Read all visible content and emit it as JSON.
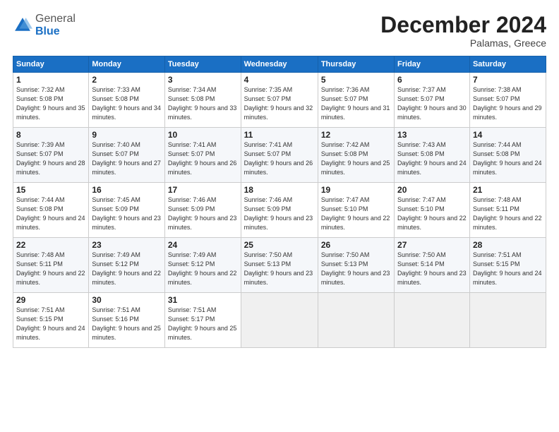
{
  "logo": {
    "general": "General",
    "blue": "Blue"
  },
  "header": {
    "month": "December 2024",
    "location": "Palamas, Greece"
  },
  "weekdays": [
    "Sunday",
    "Monday",
    "Tuesday",
    "Wednesday",
    "Thursday",
    "Friday",
    "Saturday"
  ],
  "weeks": [
    [
      {
        "day": "1",
        "sunrise": "Sunrise: 7:32 AM",
        "sunset": "Sunset: 5:08 PM",
        "daylight": "Daylight: 9 hours and 35 minutes."
      },
      {
        "day": "2",
        "sunrise": "Sunrise: 7:33 AM",
        "sunset": "Sunset: 5:08 PM",
        "daylight": "Daylight: 9 hours and 34 minutes."
      },
      {
        "day": "3",
        "sunrise": "Sunrise: 7:34 AM",
        "sunset": "Sunset: 5:08 PM",
        "daylight": "Daylight: 9 hours and 33 minutes."
      },
      {
        "day": "4",
        "sunrise": "Sunrise: 7:35 AM",
        "sunset": "Sunset: 5:07 PM",
        "daylight": "Daylight: 9 hours and 32 minutes."
      },
      {
        "day": "5",
        "sunrise": "Sunrise: 7:36 AM",
        "sunset": "Sunset: 5:07 PM",
        "daylight": "Daylight: 9 hours and 31 minutes."
      },
      {
        "day": "6",
        "sunrise": "Sunrise: 7:37 AM",
        "sunset": "Sunset: 5:07 PM",
        "daylight": "Daylight: 9 hours and 30 minutes."
      },
      {
        "day": "7",
        "sunrise": "Sunrise: 7:38 AM",
        "sunset": "Sunset: 5:07 PM",
        "daylight": "Daylight: 9 hours and 29 minutes."
      }
    ],
    [
      {
        "day": "8",
        "sunrise": "Sunrise: 7:39 AM",
        "sunset": "Sunset: 5:07 PM",
        "daylight": "Daylight: 9 hours and 28 minutes."
      },
      {
        "day": "9",
        "sunrise": "Sunrise: 7:40 AM",
        "sunset": "Sunset: 5:07 PM",
        "daylight": "Daylight: 9 hours and 27 minutes."
      },
      {
        "day": "10",
        "sunrise": "Sunrise: 7:41 AM",
        "sunset": "Sunset: 5:07 PM",
        "daylight": "Daylight: 9 hours and 26 minutes."
      },
      {
        "day": "11",
        "sunrise": "Sunrise: 7:41 AM",
        "sunset": "Sunset: 5:07 PM",
        "daylight": "Daylight: 9 hours and 26 minutes."
      },
      {
        "day": "12",
        "sunrise": "Sunrise: 7:42 AM",
        "sunset": "Sunset: 5:08 PM",
        "daylight": "Daylight: 9 hours and 25 minutes."
      },
      {
        "day": "13",
        "sunrise": "Sunrise: 7:43 AM",
        "sunset": "Sunset: 5:08 PM",
        "daylight": "Daylight: 9 hours and 24 minutes."
      },
      {
        "day": "14",
        "sunrise": "Sunrise: 7:44 AM",
        "sunset": "Sunset: 5:08 PM",
        "daylight": "Daylight: 9 hours and 24 minutes."
      }
    ],
    [
      {
        "day": "15",
        "sunrise": "Sunrise: 7:44 AM",
        "sunset": "Sunset: 5:08 PM",
        "daylight": "Daylight: 9 hours and 24 minutes."
      },
      {
        "day": "16",
        "sunrise": "Sunrise: 7:45 AM",
        "sunset": "Sunset: 5:09 PM",
        "daylight": "Daylight: 9 hours and 23 minutes."
      },
      {
        "day": "17",
        "sunrise": "Sunrise: 7:46 AM",
        "sunset": "Sunset: 5:09 PM",
        "daylight": "Daylight: 9 hours and 23 minutes."
      },
      {
        "day": "18",
        "sunrise": "Sunrise: 7:46 AM",
        "sunset": "Sunset: 5:09 PM",
        "daylight": "Daylight: 9 hours and 23 minutes."
      },
      {
        "day": "19",
        "sunrise": "Sunrise: 7:47 AM",
        "sunset": "Sunset: 5:10 PM",
        "daylight": "Daylight: 9 hours and 22 minutes."
      },
      {
        "day": "20",
        "sunrise": "Sunrise: 7:47 AM",
        "sunset": "Sunset: 5:10 PM",
        "daylight": "Daylight: 9 hours and 22 minutes."
      },
      {
        "day": "21",
        "sunrise": "Sunrise: 7:48 AM",
        "sunset": "Sunset: 5:11 PM",
        "daylight": "Daylight: 9 hours and 22 minutes."
      }
    ],
    [
      {
        "day": "22",
        "sunrise": "Sunrise: 7:48 AM",
        "sunset": "Sunset: 5:11 PM",
        "daylight": "Daylight: 9 hours and 22 minutes."
      },
      {
        "day": "23",
        "sunrise": "Sunrise: 7:49 AM",
        "sunset": "Sunset: 5:12 PM",
        "daylight": "Daylight: 9 hours and 22 minutes."
      },
      {
        "day": "24",
        "sunrise": "Sunrise: 7:49 AM",
        "sunset": "Sunset: 5:12 PM",
        "daylight": "Daylight: 9 hours and 22 minutes."
      },
      {
        "day": "25",
        "sunrise": "Sunrise: 7:50 AM",
        "sunset": "Sunset: 5:13 PM",
        "daylight": "Daylight: 9 hours and 23 minutes."
      },
      {
        "day": "26",
        "sunrise": "Sunrise: 7:50 AM",
        "sunset": "Sunset: 5:13 PM",
        "daylight": "Daylight: 9 hours and 23 minutes."
      },
      {
        "day": "27",
        "sunrise": "Sunrise: 7:50 AM",
        "sunset": "Sunset: 5:14 PM",
        "daylight": "Daylight: 9 hours and 23 minutes."
      },
      {
        "day": "28",
        "sunrise": "Sunrise: 7:51 AM",
        "sunset": "Sunset: 5:15 PM",
        "daylight": "Daylight: 9 hours and 24 minutes."
      }
    ],
    [
      {
        "day": "29",
        "sunrise": "Sunrise: 7:51 AM",
        "sunset": "Sunset: 5:15 PM",
        "daylight": "Daylight: 9 hours and 24 minutes."
      },
      {
        "day": "30",
        "sunrise": "Sunrise: 7:51 AM",
        "sunset": "Sunset: 5:16 PM",
        "daylight": "Daylight: 9 hours and 25 minutes."
      },
      {
        "day": "31",
        "sunrise": "Sunrise: 7:51 AM",
        "sunset": "Sunset: 5:17 PM",
        "daylight": "Daylight: 9 hours and 25 minutes."
      },
      null,
      null,
      null,
      null
    ]
  ]
}
